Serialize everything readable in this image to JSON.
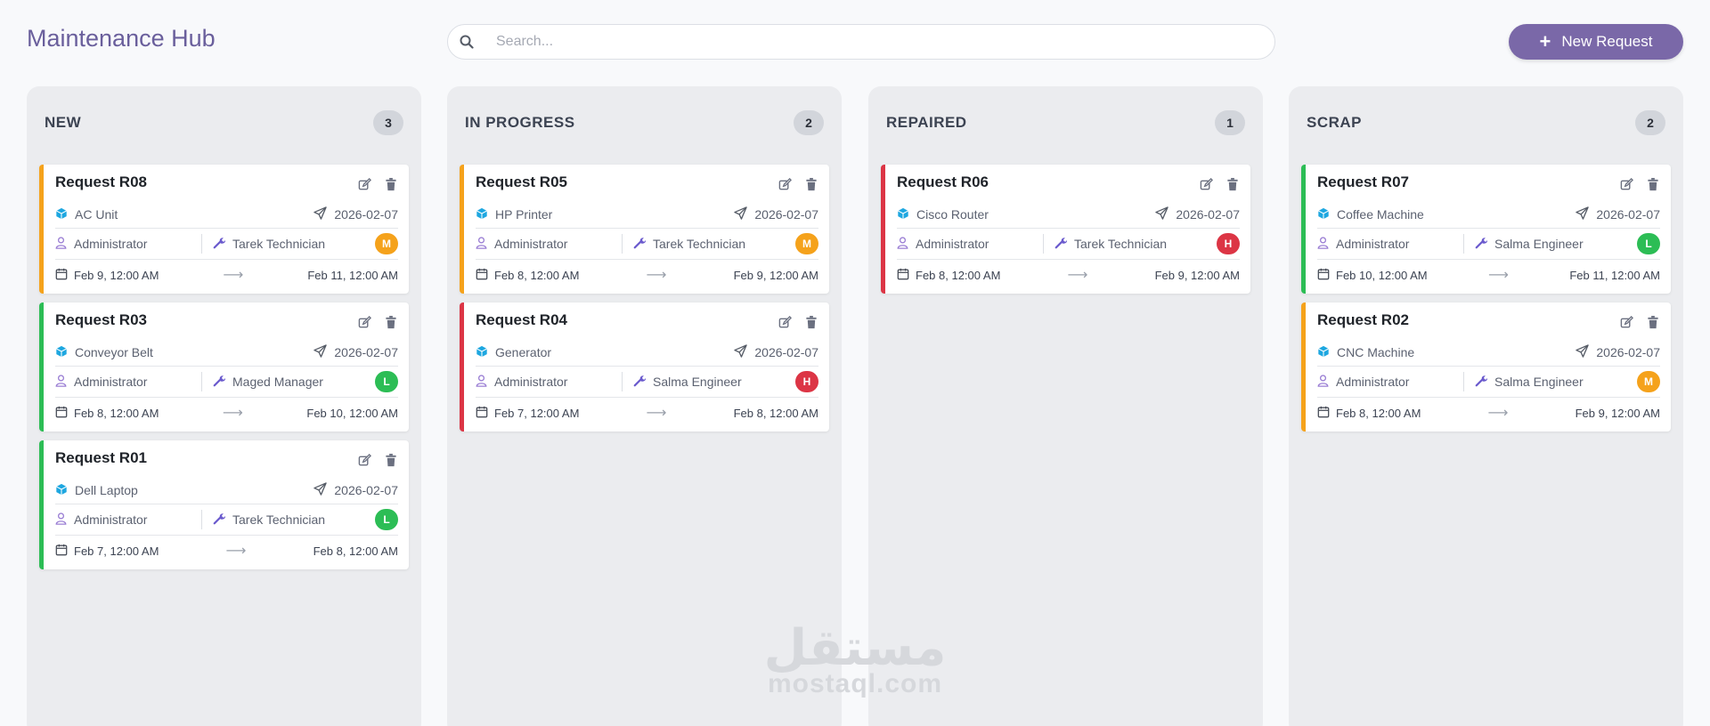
{
  "header": {
    "title": "Maintenance Hub",
    "search_placeholder": "Search...",
    "new_request_label": "New Request"
  },
  "colors": {
    "accent": "#7a68a8",
    "priority_high": "#dc3545",
    "priority_medium": "#f5a21b",
    "priority_low": "#2cbd55"
  },
  "watermark": {
    "arabic": "مستقل",
    "latin": "mostaql.com"
  },
  "columns": [
    {
      "title": "NEW",
      "count": "3",
      "cards": [
        {
          "title": "Request R08",
          "equipment": "AC Unit",
          "date": "2026-02-07",
          "creator": "Administrator",
          "technician": "Tarek Technician",
          "priority": "M",
          "start": "Feb 9, 12:00 AM",
          "end": "Feb 11, 12:00 AM",
          "border": "orange"
        },
        {
          "title": "Request R03",
          "equipment": "Conveyor Belt",
          "date": "2026-02-07",
          "creator": "Administrator",
          "technician": "Maged Manager",
          "priority": "L",
          "start": "Feb 8, 12:00 AM",
          "end": "Feb 10, 12:00 AM",
          "border": "green"
        },
        {
          "title": "Request R01",
          "equipment": "Dell Laptop",
          "date": "2026-02-07",
          "creator": "Administrator",
          "technician": "Tarek Technician",
          "priority": "L",
          "start": "Feb 7, 12:00 AM",
          "end": "Feb 8, 12:00 AM",
          "border": "green"
        }
      ]
    },
    {
      "title": "IN PROGRESS",
      "count": "2",
      "cards": [
        {
          "title": "Request R05",
          "equipment": "HP Printer",
          "date": "2026-02-07",
          "creator": "Administrator",
          "technician": "Tarek Technician",
          "priority": "M",
          "start": "Feb 8, 12:00 AM",
          "end": "Feb 9, 12:00 AM",
          "border": "orange"
        },
        {
          "title": "Request R04",
          "equipment": "Generator",
          "date": "2026-02-07",
          "creator": "Administrator",
          "technician": "Salma Engineer",
          "priority": "H",
          "start": "Feb 7, 12:00 AM",
          "end": "Feb 8, 12:00 AM",
          "border": "red"
        }
      ]
    },
    {
      "title": "REPAIRED",
      "count": "1",
      "cards": [
        {
          "title": "Request R06",
          "equipment": "Cisco Router",
          "date": "2026-02-07",
          "creator": "Administrator",
          "technician": "Tarek Technician",
          "priority": "H",
          "start": "Feb 8, 12:00 AM",
          "end": "Feb 9, 12:00 AM",
          "border": "red"
        }
      ]
    },
    {
      "title": "SCRAP",
      "count": "2",
      "cards": [
        {
          "title": "Request R07",
          "equipment": "Coffee Machine",
          "date": "2026-02-07",
          "creator": "Administrator",
          "technician": "Salma Engineer",
          "priority": "L",
          "start": "Feb 10, 12:00 AM",
          "end": "Feb 11, 12:00 AM",
          "border": "green"
        },
        {
          "title": "Request R02",
          "equipment": "CNC Machine",
          "date": "2026-02-07",
          "creator": "Administrator",
          "technician": "Salma Engineer",
          "priority": "M",
          "start": "Feb 8, 12:00 AM",
          "end": "Feb 9, 12:00 AM",
          "border": "orange"
        }
      ]
    }
  ]
}
